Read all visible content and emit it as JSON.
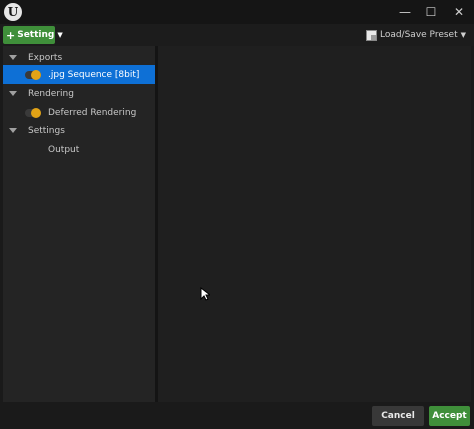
{
  "window": {
    "logo_glyph": "U",
    "minimize_glyph": "—",
    "maximize_glyph": "☐",
    "close_glyph": "✕"
  },
  "toolbar": {
    "add_label": "Setting",
    "add_glyph": "+",
    "dropdown_glyph": "▼",
    "preset_label": "Load/Save Preset",
    "preset_dropdown_glyph": "▼"
  },
  "tree": {
    "exports": {
      "label": "Exports",
      "items": [
        {
          "label": ".jpg Sequence [8bit]",
          "enabled": true,
          "selected": true
        }
      ]
    },
    "rendering": {
      "label": "Rendering",
      "items": [
        {
          "label": "Deferred Rendering",
          "enabled": true,
          "selected": false
        }
      ]
    },
    "settings": {
      "label": "Settings",
      "items": [
        {
          "label": "Output",
          "selected": false
        }
      ]
    }
  },
  "footer": {
    "cancel_label": "Cancel",
    "accept_label": "Accept"
  },
  "colors": {
    "accent_green": "#3f8f3a",
    "selection_blue": "#0e70d6",
    "toggle_on": "#e2a316"
  }
}
